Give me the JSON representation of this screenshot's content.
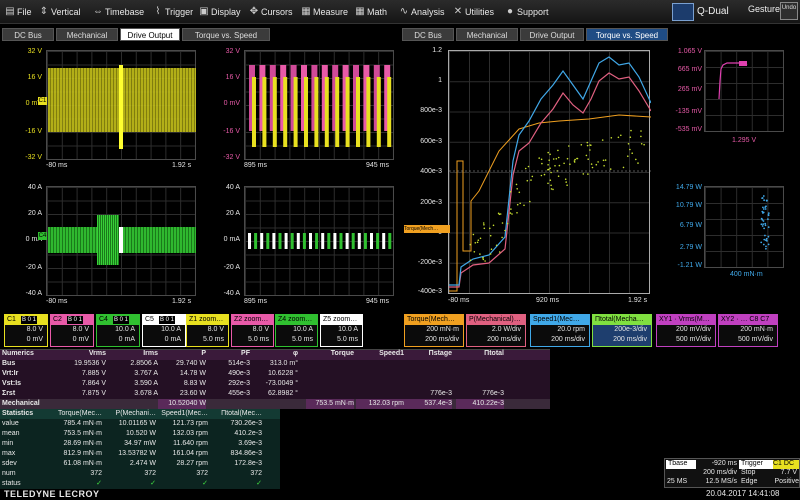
{
  "menu": [
    {
      "icon": "file-icon",
      "glyph": "▤",
      "label": "File"
    },
    {
      "icon": "vertical-icon",
      "glyph": "⇕",
      "label": "Vertical"
    },
    {
      "icon": "timebase-icon",
      "glyph": "⇔",
      "label": "Timebase"
    },
    {
      "icon": "trigger-icon",
      "glyph": "⌇",
      "label": "Trigger"
    },
    {
      "icon": "display-icon",
      "glyph": "▣",
      "label": "Display"
    },
    {
      "icon": "cursors-icon",
      "glyph": "✥",
      "label": "Cursors"
    },
    {
      "icon": "measure-icon",
      "glyph": "▦",
      "label": "Measure"
    },
    {
      "icon": "math-icon",
      "glyph": "▦",
      "label": "Math"
    },
    {
      "icon": "analysis-icon",
      "glyph": "∿",
      "label": "Analysis"
    },
    {
      "icon": "utilities-icon",
      "glyph": "✕",
      "label": "Utilities"
    },
    {
      "icon": "support-icon",
      "glyph": "●",
      "label": "Support"
    }
  ],
  "header_right": {
    "mode": "Q-Dual",
    "gesture": "Gesture",
    "undo": "Undo"
  },
  "tabs_left": [
    "DC Bus",
    "Mechanical",
    "Drive Output",
    "Torque vs. Speed"
  ],
  "tabs_right": [
    "DC Bus",
    "Mechanical",
    "Drive Output",
    "Torque vs. Speed"
  ],
  "plots": {
    "p1": {
      "y": [
        "32 V",
        "16 V",
        "0 mV",
        "-16 V",
        "-32 V"
      ],
      "x0": "-80 ms",
      "x1": "1.92 s"
    },
    "p2": {
      "y": [
        "32 V",
        "16 V",
        "0 mV",
        "-16 V",
        "-32 V"
      ],
      "x0": "895 ms",
      "x1": "945 ms"
    },
    "p3": {
      "y": [
        "40 A",
        "20 A",
        "0 mA",
        "-20 A",
        "-40 A"
      ],
      "x0": "-80 ms",
      "x1": "1.92 s"
    },
    "p4": {
      "y": [
        "40 A",
        "20 A",
        "0 mA",
        "-20 A",
        "-40 A"
      ],
      "x0": "895 ms",
      "x1": "945 ms"
    },
    "main": {
      "y": [
        "1.2",
        "1",
        "800e-3",
        "600e-3",
        "400e-3",
        "200e-3",
        "0",
        "-200e-3",
        "-400e-3"
      ],
      "x0": "-80 ms",
      "x1": "920 ms",
      "x2": "1.92 s",
      "marker": "Torque(Mech…"
    },
    "xy1": {
      "y": [
        "1.065 V",
        "665 mV",
        "265 mV",
        "-135 mV",
        "-535 mV"
      ],
      "x": "1.295 V"
    },
    "xy2": {
      "y": [
        "14.79 W",
        "10.79 W",
        "6.79 W",
        "2.79 W",
        "-1.21 W"
      ],
      "x": "400 mN·m"
    }
  },
  "channels": [
    {
      "name": "C1",
      "tag": "B 0 1",
      "color": "#e8e020",
      "v1": "8.0 V",
      "v2": "0 mV"
    },
    {
      "name": "C2",
      "tag": "B 0 1",
      "color": "#e85aa8",
      "v1": "8.0 V",
      "v2": "0 mV"
    },
    {
      "name": "C4",
      "tag": "B 0 1",
      "color": "#30c030",
      "v1": "10.0 A",
      "v2": "0 mA"
    },
    {
      "name": "C5",
      "tag": "B 0 1",
      "color": "#ffffff",
      "v1": "10.0 A",
      "v2": "0 mA"
    },
    {
      "name": "Z1 zoom…",
      "tag": "",
      "color": "#e8e020",
      "v1": "8.0 V",
      "v2": "5.0 ms"
    },
    {
      "name": "Z2 zoom…",
      "tag": "",
      "color": "#e85aa8",
      "v1": "8.0 V",
      "v2": "5.0 ms"
    },
    {
      "name": "Z4 zoom…",
      "tag": "",
      "color": "#30c030",
      "v1": "10.0 A",
      "v2": "5.0 ms"
    },
    {
      "name": "Z5 zoom…",
      "tag": "",
      "color": "#ffffff",
      "v1": "10.0 A",
      "v2": "5.0 ms"
    }
  ],
  "math_channels": [
    {
      "name": "Torque(Mech…",
      "color": "#f0a020",
      "v1": "200 mN·m",
      "v2": "200 ms/div"
    },
    {
      "name": "P(Mechanical)…",
      "color": "#e06080",
      "v1": "2.0 W/div",
      "v2": "200 ms/div"
    },
    {
      "name": "Speed1(Mec…",
      "color": "#40a8e8",
      "v1": "20.0 rpm",
      "v2": "200 ms/div"
    },
    {
      "name": "Πtotal(Mecha…",
      "color": "#80e040",
      "v1": "200e-3/div",
      "v2": "200 ms/div"
    },
    {
      "name": "XY1 · Vrms(M…",
      "color": "#c040c0",
      "v1": "200 mV/div",
      "v2": "500 mV/div"
    },
    {
      "name": "XY2 · …  C8 C7",
      "color": "#c040c0",
      "v1": "200 mN·m",
      "v2": "500 mV/div"
    }
  ],
  "numerics": {
    "title": "Numerics",
    "headers": [
      "Vrms",
      "Irms",
      "P",
      "PF",
      "φ",
      "Torque",
      "Speed1",
      "Πstage",
      "Πtotal"
    ],
    "rows": [
      {
        "label": "Bus",
        "cells": [
          "19.9536 V",
          "2.8506 A",
          "29.740 W",
          "514e-3",
          "313.0 m°",
          "",
          "",
          "",
          ""
        ]
      },
      {
        "label": "Vrt:Ir",
        "cells": [
          "7.885 V",
          "3.767 A",
          "14.78 W",
          "490e-3",
          "10.6228 °",
          "",
          "",
          "",
          ""
        ]
      },
      {
        "label": "Vst:Is",
        "cells": [
          "7.864 V",
          "3.590 A",
          "8.83 W",
          "292e-3",
          "-73.0049 °",
          "",
          "",
          "",
          ""
        ]
      },
      {
        "label": "Σrst",
        "cells": [
          "7.875 V",
          "3.678 A",
          "23.60 W",
          "455e-3",
          "62.8982 °",
          "",
          "",
          "776e-3",
          "776e-3"
        ]
      },
      {
        "label": "Mechanical",
        "cells": [
          "",
          "",
          "10.52040 W",
          "",
          "",
          "753.5 mN·m",
          "132.03 rpm",
          "537.4e-3",
          "410.22e-3"
        ]
      }
    ]
  },
  "statistics": {
    "title": "Statistics",
    "headers": [
      "Torque(Mec…",
      "P(Mechani…",
      "Speed1(Mec…",
      "Πtotal(Mec…"
    ],
    "rows": [
      {
        "label": "value",
        "cells": [
          "785.4 mN·m",
          "10.01165 W",
          "121.73 rpm",
          "730.26e-3"
        ]
      },
      {
        "label": "mean",
        "cells": [
          "753.5 mN·m",
          "10.520 W",
          "132.03 rpm",
          "410.2e-3"
        ]
      },
      {
        "label": "min",
        "cells": [
          "28.69 mN·m",
          "34.97 mW",
          "11.640 rpm",
          "3.69e-3"
        ]
      },
      {
        "label": "max",
        "cells": [
          "812.9 mN·m",
          "13.53782 W",
          "161.04 rpm",
          "834.86e-3"
        ]
      },
      {
        "label": "sdev",
        "cells": [
          "61.08 mN·m",
          "2.474 W",
          "28.27 rpm",
          "172.8e-3"
        ]
      },
      {
        "label": "num",
        "cells": [
          "372",
          "372",
          "372",
          "372"
        ]
      },
      {
        "label": "status",
        "cells": [
          "✓",
          "✓",
          "✓",
          "✓"
        ]
      }
    ]
  },
  "timebase": {
    "tbase": "Tbase",
    "offset": "-920 ms",
    "rate1": "200 ms/div",
    "samples": "25 MS",
    "rate2": "12.5 MS/s",
    "trigger": "Trigger",
    "trig_tag": "C1 DC",
    "mode": "Stop",
    "level": "7.7 V",
    "type": "Edge",
    "slope": "Positive"
  },
  "footer": {
    "brand": "TELEDYNE LECROY",
    "datetime": "20.04.2017 14:41:08"
  }
}
